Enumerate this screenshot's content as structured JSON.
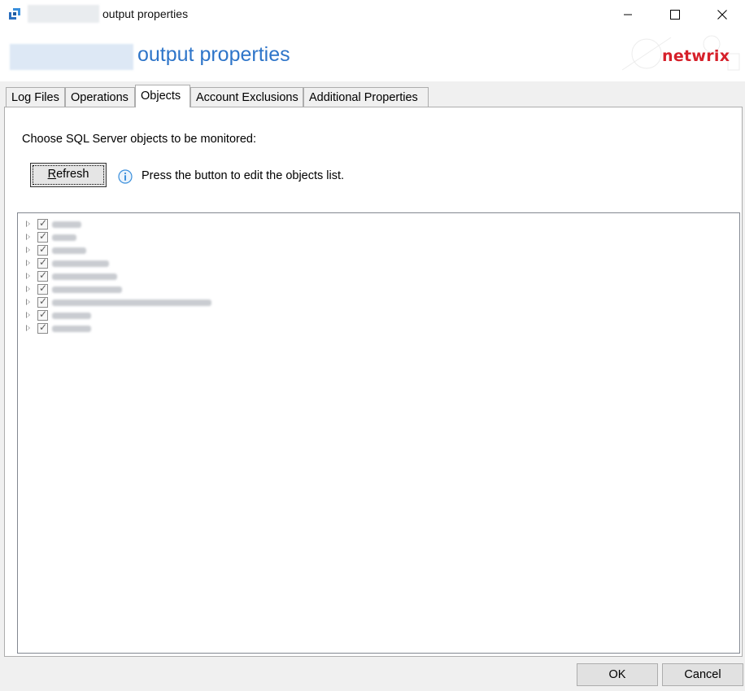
{
  "window": {
    "title": "output properties",
    "controls": {
      "minimize": "—",
      "maximize": "☐",
      "close": "✕"
    }
  },
  "banner": {
    "title": "output properties",
    "logo_text": "netwrix",
    "brand_color": "#d6202a",
    "title_color": "#2e75c9"
  },
  "tabs": [
    {
      "label": "Log Files",
      "active": false
    },
    {
      "label": "Operations",
      "active": false
    },
    {
      "label": "Objects",
      "active": true
    },
    {
      "label": "Account Exclusions",
      "active": false
    },
    {
      "label": "Additional Properties",
      "active": false
    }
  ],
  "objects_panel": {
    "instruction": "Choose SQL Server objects to be monitored:",
    "refresh_button": {
      "label_accel": "R",
      "label_rest": "efresh"
    },
    "info_icon": "info-circle-icon",
    "hint": "Press the button to edit the objects list."
  },
  "tree": {
    "items": [
      {
        "checked": true,
        "expandable": true
      },
      {
        "checked": true,
        "expandable": true
      },
      {
        "checked": true,
        "expandable": true
      },
      {
        "checked": true,
        "expandable": true
      },
      {
        "checked": true,
        "expandable": true
      },
      {
        "checked": true,
        "expandable": true
      },
      {
        "checked": true,
        "expandable": true
      },
      {
        "checked": true,
        "expandable": true
      },
      {
        "checked": true,
        "expandable": true
      }
    ]
  },
  "footer": {
    "ok_label": "OK",
    "cancel_label": "Cancel"
  }
}
